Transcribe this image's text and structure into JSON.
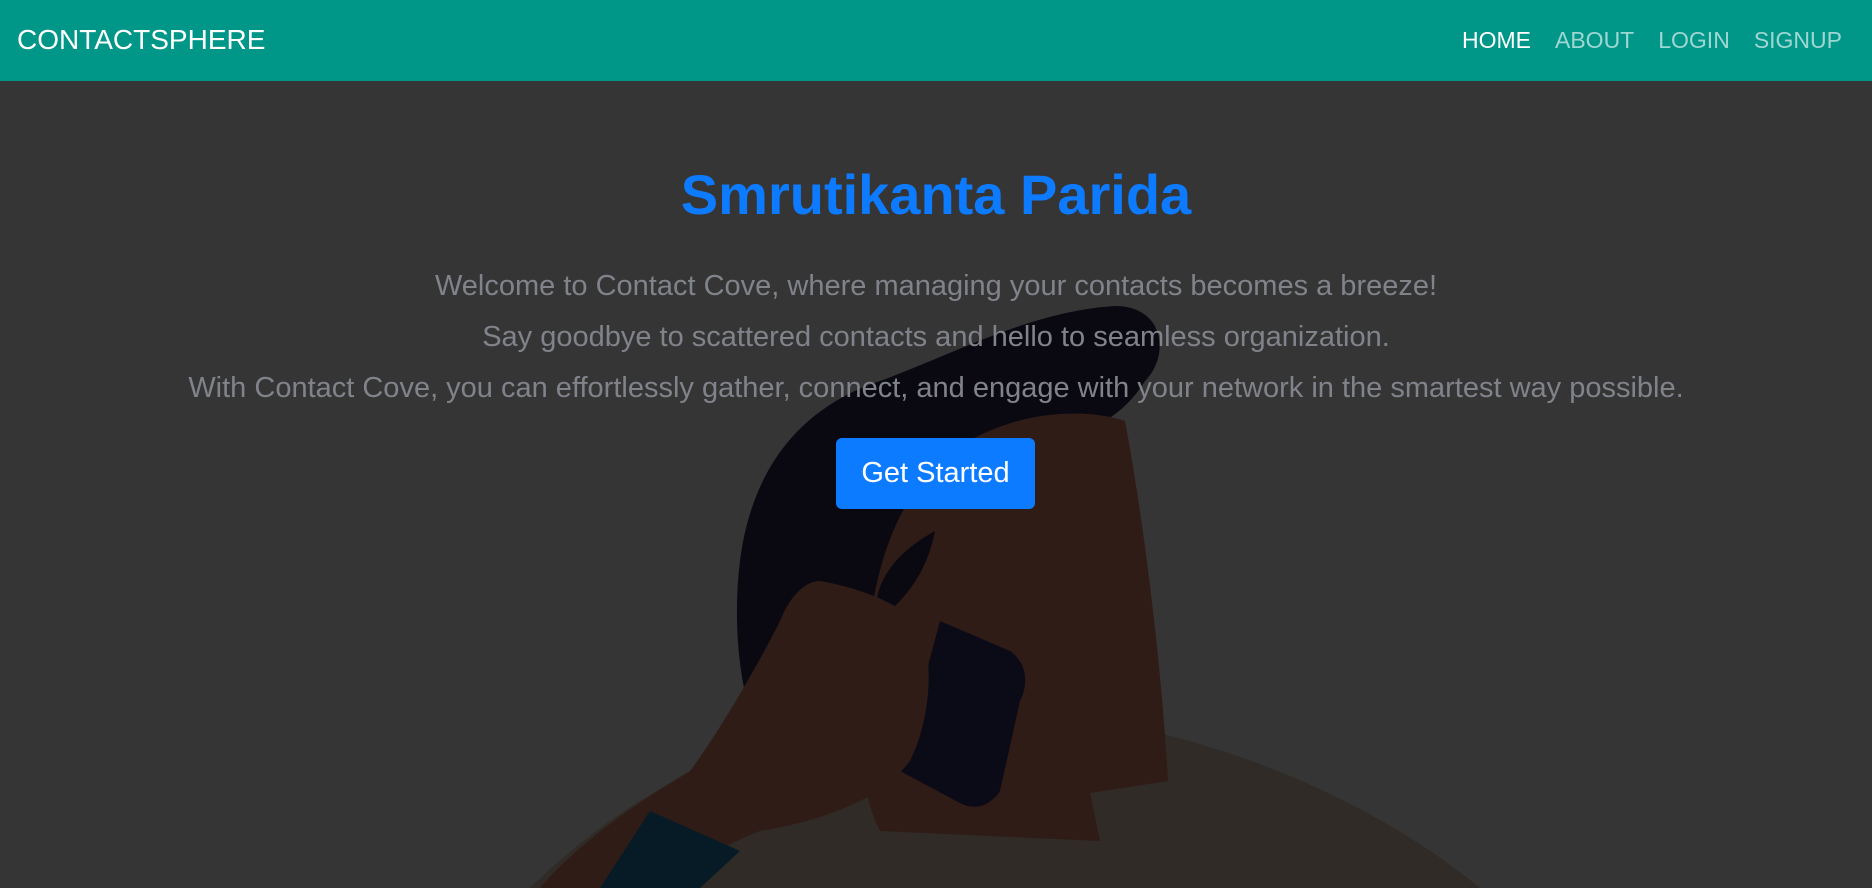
{
  "navbar": {
    "brand": "CONTACTSPHERE",
    "links": [
      {
        "label": "HOME",
        "active": true
      },
      {
        "label": "ABOUT",
        "active": false
      },
      {
        "label": "LOGIN",
        "active": false
      },
      {
        "label": "SIGNUP",
        "active": false
      }
    ]
  },
  "hero": {
    "title": "Smrutikanta Parida",
    "lines": [
      "Welcome to Contact Cove, where managing your contacts becomes a breeze!",
      "Say goodbye to scattered contacts and hello to seamless organization.",
      "With Contact Cove, you can effortlessly gather, connect, and engage with your network in the smartest way possible."
    ],
    "cta_label": "Get Started"
  },
  "colors": {
    "navbar": "#009688",
    "background": "#353535",
    "accent": "#0d7bff",
    "lead_text": "#80838a"
  },
  "illustration": {
    "subject": "person-on-phone-illustration"
  }
}
